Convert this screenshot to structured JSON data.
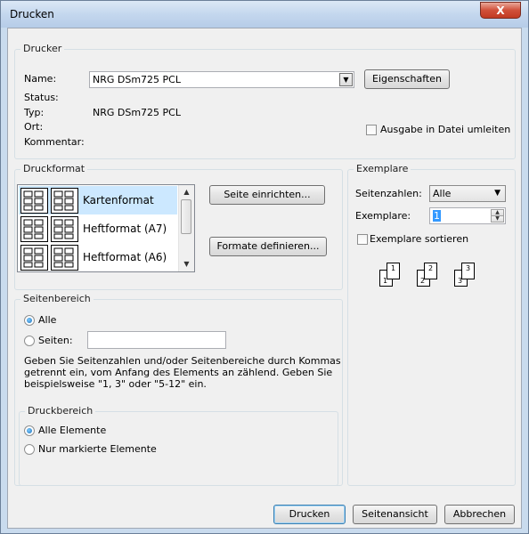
{
  "window": {
    "title": "Drucken",
    "close_glyph": "X"
  },
  "drucker": {
    "legend": "Drucker",
    "name_label": "Name:",
    "name_value": "NRG DSm725 PCL",
    "properties_button": "Eigenschaften",
    "status_label": "Status:",
    "typ_label": "Typ:",
    "typ_value": "NRG DSm725 PCL",
    "ort_label": "Ort:",
    "kommentar_label": "Kommentar:",
    "print_to_file_label": "Ausgabe in Datei umleiten"
  },
  "druckformat": {
    "legend": "Druckformat",
    "items": [
      {
        "label": "Kartenformat",
        "selected": true
      },
      {
        "label": "Heftformat (A7)",
        "selected": false
      },
      {
        "label": "Heftformat (A6)",
        "selected": false
      }
    ],
    "page_setup_button": "Seite einrichten...",
    "define_formats_button": "Formate definieren..."
  },
  "exemplare": {
    "legend": "Exemplare",
    "page_numbers_label": "Seitenzahlen:",
    "page_numbers_value": "Alle",
    "copies_label": "Exemplare:",
    "copies_value": "1",
    "collate_label": "Exemplare sortieren",
    "collate_pages": [
      "1",
      "1",
      "2",
      "2",
      "3",
      "3"
    ]
  },
  "seitenbereich": {
    "legend": "Seitenbereich",
    "all_label": "Alle",
    "pages_label": "Seiten:",
    "pages_value": "",
    "help_text_1": "Geben Sie Seitenzahlen und/oder Seitenbereiche durch Kommas",
    "help_text_2": "getrennt ein, vom Anfang des Elements an zählend. Geben Sie",
    "help_text_3": "beispielsweise \"1, 3\" oder \"5-12\" ein."
  },
  "druckbereich": {
    "legend": "Druckbereich",
    "all_elements_label": "Alle Elemente",
    "marked_elements_label": "Nur markierte Elemente"
  },
  "buttons": {
    "print": "Drucken",
    "preview": "Seitenansicht",
    "cancel": "Abbrechen"
  },
  "icons": {
    "close": "close-icon",
    "dropdown": "chevron-down-icon",
    "format": "card-layout-icon"
  }
}
